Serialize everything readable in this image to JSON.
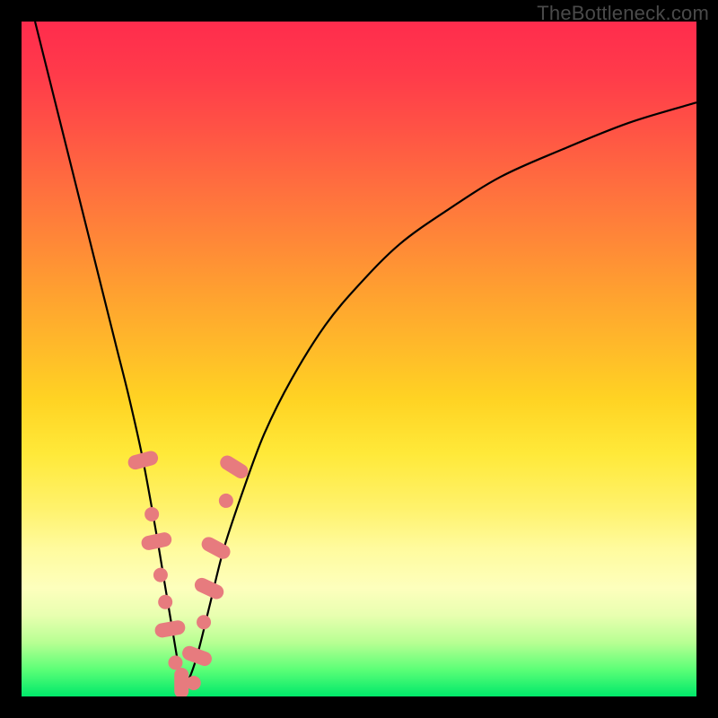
{
  "watermark": "TheBottleneck.com",
  "colors": {
    "frame": "#000000",
    "curve": "#000000",
    "marker_fill": "#e77b7e",
    "marker_stroke": "#d96a6d"
  },
  "chart_data": {
    "type": "line",
    "title": "",
    "xlabel": "",
    "ylabel": "",
    "xlim": [
      0,
      100
    ],
    "ylim": [
      0,
      100
    ],
    "grid": false,
    "series": [
      {
        "name": "bottleneck-curve",
        "x": [
          2,
          4,
          6,
          8,
          10,
          12,
          14,
          16,
          18,
          20,
          21,
          22,
          23,
          23.7,
          24.5,
          26,
          28,
          30,
          33,
          36,
          40,
          45,
          50,
          56,
          63,
          71,
          80,
          90,
          100
        ],
        "y": [
          100,
          92,
          84,
          76,
          68,
          60,
          52,
          44,
          35,
          24,
          18,
          12,
          6,
          2,
          2,
          6,
          14,
          22,
          31,
          39,
          47,
          55,
          61,
          67,
          72,
          77,
          81,
          85,
          88
        ]
      }
    ],
    "markers": [
      {
        "x": 18.0,
        "y": 35,
        "shape": "pill",
        "angle": 75
      },
      {
        "x": 19.3,
        "y": 27,
        "shape": "circle"
      },
      {
        "x": 20.0,
        "y": 23,
        "shape": "pill",
        "angle": 78
      },
      {
        "x": 20.6,
        "y": 18,
        "shape": "circle"
      },
      {
        "x": 21.3,
        "y": 14,
        "shape": "circle"
      },
      {
        "x": 22.0,
        "y": 10,
        "shape": "pill",
        "angle": 80
      },
      {
        "x": 22.8,
        "y": 5,
        "shape": "circle"
      },
      {
        "x": 23.7,
        "y": 2,
        "shape": "pill",
        "angle": 0
      },
      {
        "x": 25.5,
        "y": 2,
        "shape": "circle"
      },
      {
        "x": 26.0,
        "y": 6,
        "shape": "pill",
        "angle": -70
      },
      {
        "x": 27.0,
        "y": 11,
        "shape": "circle"
      },
      {
        "x": 27.8,
        "y": 16,
        "shape": "pill",
        "angle": -65
      },
      {
        "x": 28.8,
        "y": 22,
        "shape": "pill",
        "angle": -62
      },
      {
        "x": 30.3,
        "y": 29,
        "shape": "circle"
      },
      {
        "x": 31.5,
        "y": 34,
        "shape": "pill",
        "angle": -58
      }
    ]
  }
}
